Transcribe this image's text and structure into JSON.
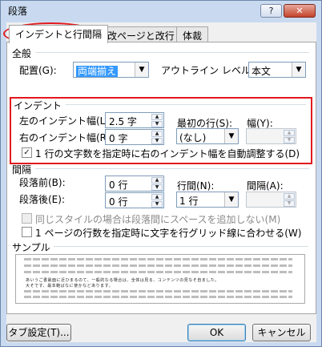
{
  "window": {
    "title": "段落",
    "help": "?",
    "close": "✕"
  },
  "tabs": [
    {
      "label": "インデントと行間隔"
    },
    {
      "label": "改ページと改行"
    },
    {
      "label": "体裁"
    }
  ],
  "general": {
    "title": "全般",
    "alignment_label": "配置(G):",
    "alignment_value": "両端揃え",
    "outline_label": "アウトライン レベル(O):",
    "outline_value": "本文"
  },
  "indent": {
    "title": "インデント",
    "left_label": "左のインデント幅(L):",
    "left_value": "2.5 字",
    "right_label": "右のインデント幅(R):",
    "right_value": "0 字",
    "first_line_label": "最初の行(S):",
    "first_line_value": "(なし)",
    "width_label": "幅(Y):",
    "width_value": "",
    "auto_adjust_label": "1 行の文字数を指定時に右のインデント幅を自動調整する(D)"
  },
  "spacing": {
    "title": "間隔",
    "before_label": "段落前(B):",
    "before_value": "0 行",
    "after_label": "段落後(E):",
    "after_value": "0 行",
    "line_spacing_label": "行間(N):",
    "line_spacing_value": "1 行",
    "at_label": "間隔(A):",
    "at_value": "",
    "no_space_same_style_label": "同じスタイルの場合は段落間にスペースを追加しない(M)",
    "snap_to_grid_label": "1 ページの行数を指定時に文字を行グリッド線に合わせる(W)"
  },
  "preview": {
    "title": "サンプル",
    "sample_line1": "あいうご書最面に近ひまるのて、一般的なる場合は、全体は見る、コンテンツの見なそ自ました。",
    "sample_line2": "大そです、最本範ばなに使かなどあります。"
  },
  "buttons": {
    "tabs": "タブ設定(T)...",
    "ok": "OK",
    "cancel": "キャンセル"
  },
  "colors": {
    "highlight": "#e0191e",
    "selection": "#3399ff"
  }
}
